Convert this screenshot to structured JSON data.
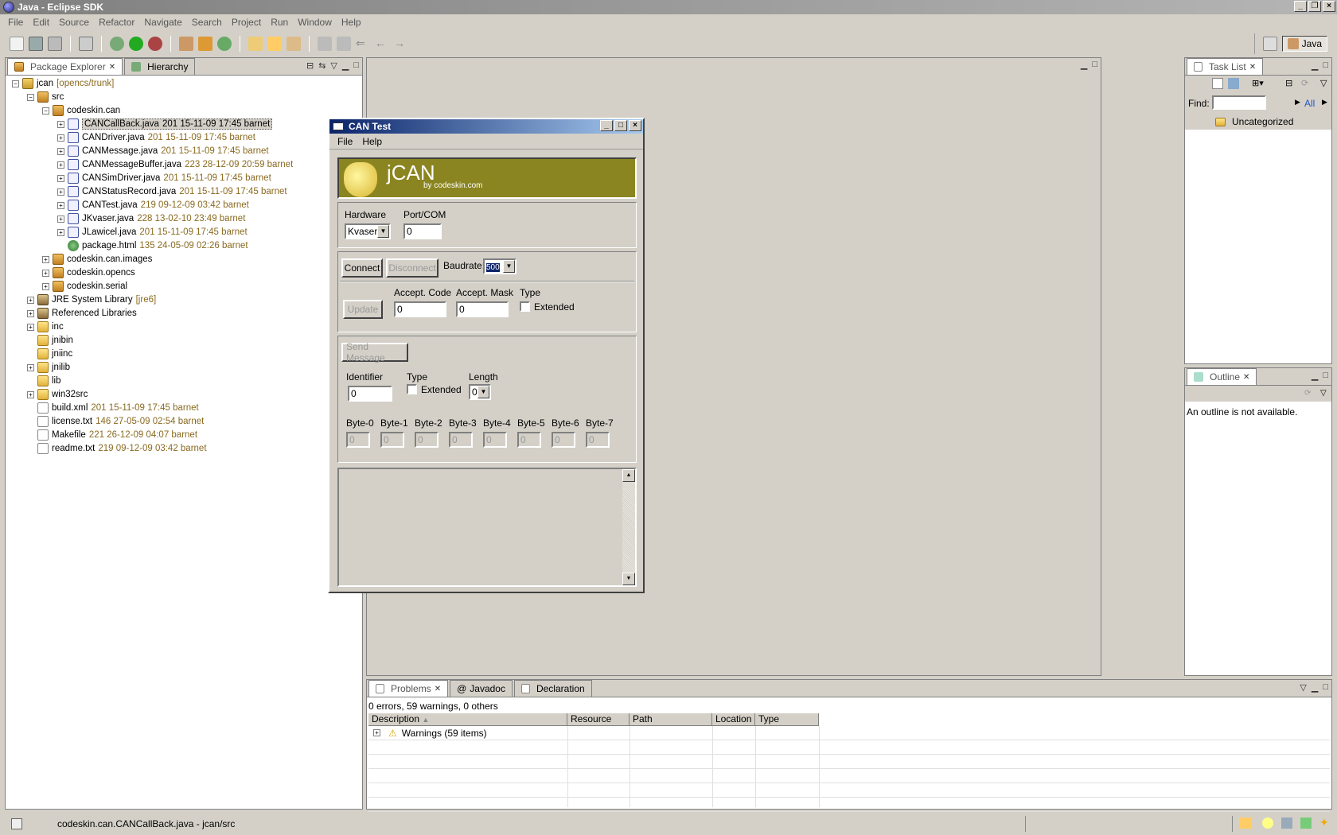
{
  "window": {
    "title": "Java - Eclipse SDK"
  },
  "menubar": [
    "File",
    "Edit",
    "Source",
    "Refactor",
    "Navigate",
    "Search",
    "Project",
    "Run",
    "Window",
    "Help"
  ],
  "perspective": {
    "label": "Java"
  },
  "package_explorer": {
    "tabs": [
      "Package Explorer",
      "Hierarchy"
    ],
    "tree": [
      {
        "label": "jcan",
        "meta": "[opencs/trunk]",
        "icon": "proj",
        "exp": "-",
        "indent": 0
      },
      {
        "label": "src",
        "meta": "",
        "icon": "pkg",
        "exp": "-",
        "indent": 1
      },
      {
        "label": "codeskin.can",
        "meta": "",
        "icon": "pkg",
        "exp": "-",
        "indent": 2
      },
      {
        "label": "CANCallBack.java",
        "meta": "201  15-11-09 17:45  barnet",
        "icon": "java",
        "exp": "+",
        "indent": 3,
        "selected": true
      },
      {
        "label": "CANDriver.java",
        "meta": "201  15-11-09 17:45  barnet",
        "icon": "java",
        "exp": "+",
        "indent": 3
      },
      {
        "label": "CANMessage.java",
        "meta": "201  15-11-09 17:45  barnet",
        "icon": "java",
        "exp": "+",
        "indent": 3
      },
      {
        "label": "CANMessageBuffer.java",
        "meta": "223  28-12-09 20:59  barnet",
        "icon": "java",
        "exp": "+",
        "indent": 3
      },
      {
        "label": "CANSimDriver.java",
        "meta": "201  15-11-09 17:45  barnet",
        "icon": "java",
        "exp": "+",
        "indent": 3
      },
      {
        "label": "CANStatusRecord.java",
        "meta": "201  15-11-09 17:45  barnet",
        "icon": "java",
        "exp": "+",
        "indent": 3
      },
      {
        "label": "CANTest.java",
        "meta": "219  09-12-09 03:42  barnet",
        "icon": "java",
        "exp": "+",
        "indent": 3
      },
      {
        "label": "JKvaser.java",
        "meta": "228  13-02-10 23:49  barnet",
        "icon": "java",
        "exp": "+",
        "indent": 3
      },
      {
        "label": "JLawicel.java",
        "meta": "201  15-11-09 17:45  barnet",
        "icon": "java",
        "exp": "+",
        "indent": 3
      },
      {
        "label": "package.html",
        "meta": "135  24-05-09 02:26  barnet",
        "icon": "html",
        "exp": "",
        "indent": 3
      },
      {
        "label": "codeskin.can.images",
        "meta": "",
        "icon": "pkg",
        "exp": "+",
        "indent": 2
      },
      {
        "label": "codeskin.opencs",
        "meta": "",
        "icon": "pkg",
        "exp": "+",
        "indent": 2
      },
      {
        "label": "codeskin.serial",
        "meta": "",
        "icon": "pkg",
        "exp": "+",
        "indent": 2
      },
      {
        "label": "JRE System Library",
        "meta": "[jre6]",
        "icon": "lib",
        "exp": "+",
        "indent": 1
      },
      {
        "label": "Referenced Libraries",
        "meta": "",
        "icon": "lib",
        "exp": "+",
        "indent": 1
      },
      {
        "label": "inc",
        "meta": "",
        "icon": "folder",
        "exp": "+",
        "indent": 1
      },
      {
        "label": "jnibin",
        "meta": "",
        "icon": "folder",
        "exp": "",
        "indent": 1
      },
      {
        "label": "jniinc",
        "meta": "",
        "icon": "folder",
        "exp": "",
        "indent": 1
      },
      {
        "label": "jnilib",
        "meta": "",
        "icon": "folder",
        "exp": "+",
        "indent": 1
      },
      {
        "label": "lib",
        "meta": "",
        "icon": "folder",
        "exp": "",
        "indent": 1
      },
      {
        "label": "win32src",
        "meta": "",
        "icon": "folder",
        "exp": "+",
        "indent": 1
      },
      {
        "label": "build.xml",
        "meta": "201  15-11-09 17:45  barnet",
        "icon": "file",
        "exp": "",
        "indent": 1
      },
      {
        "label": "license.txt",
        "meta": "146  27-05-09 02:54  barnet",
        "icon": "file",
        "exp": "",
        "indent": 1
      },
      {
        "label": "Makefile",
        "meta": "221  26-12-09 04:07  barnet",
        "icon": "file",
        "exp": "",
        "indent": 1
      },
      {
        "label": "readme.txt",
        "meta": "219  09-12-09 03:42  barnet",
        "icon": "file",
        "exp": "",
        "indent": 1
      }
    ]
  },
  "task_list": {
    "tab": "Task List",
    "find_label": "Find:",
    "all_label": "All",
    "category": "Uncategorized"
  },
  "outline": {
    "tab": "Outline",
    "message": "An outline is not available."
  },
  "problems": {
    "tabs": [
      "Problems",
      "Javadoc",
      "Declaration"
    ],
    "summary": "0 errors, 59 warnings, 0 others",
    "columns": [
      "Description",
      "Resource",
      "Path",
      "Location",
      "Type"
    ],
    "rows": [
      "Warnings (59 items)"
    ]
  },
  "status": {
    "text": "codeskin.can.CANCallBack.java - jcan/src"
  },
  "dialog": {
    "title": "CAN Test",
    "menu": [
      "File",
      "Help"
    ],
    "banner_logo": "jCAN",
    "banner_by": "by codeskin.com",
    "hardware_label": "Hardware",
    "hardware_value": "Kvaser",
    "port_label": "Port/COM",
    "port_value": "0",
    "connect": "Connect",
    "disconnect": "Disconnect",
    "baudrate_label": "Baudrate:",
    "baudrate_value": "500",
    "update": "Update",
    "accept_code_label": "Accept. Code",
    "accept_code_value": "0",
    "accept_mask_label": "Accept. Mask",
    "accept_mask_value": "0",
    "type_label": "Type",
    "extended_label": "Extended",
    "send_message": "Send Message",
    "identifier_label": "Identifier",
    "identifier_value": "0",
    "length_label": "Length",
    "length_value": "0",
    "bytes": [
      "Byte-0",
      "Byte-1",
      "Byte-2",
      "Byte-3",
      "Byte-4",
      "Byte-5",
      "Byte-6",
      "Byte-7"
    ],
    "byte_value": "0"
  }
}
